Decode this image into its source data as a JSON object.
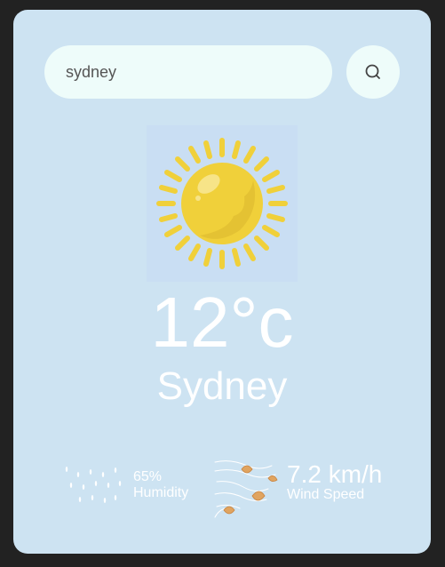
{
  "search": {
    "value": "sydney"
  },
  "weather": {
    "temperature": "12°c",
    "city": "Sydney",
    "icon": "sun-icon"
  },
  "details": {
    "humidity_value": "65%",
    "humidity_label": "Humidity",
    "wind_value": "7.2 km/h",
    "wind_label": "Wind Speed"
  },
  "colors": {
    "card": "#cde3f2",
    "input": "#eefcfa",
    "sun": "#f0d03a",
    "text": "#ffffff"
  }
}
